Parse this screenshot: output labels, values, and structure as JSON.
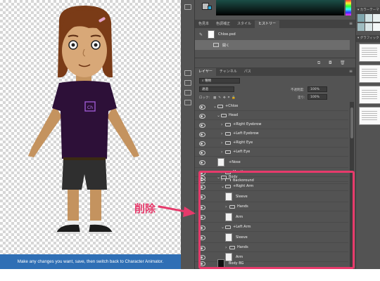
{
  "canvas": {
    "tip_text": "Make any changes you want, save, then switch back to Character Animator.",
    "character": {
      "shirt_color": "#2d1038",
      "badge_text": "Ch",
      "badge_color": "#9b59d0"
    }
  },
  "history_panel": {
    "tabs": [
      "色見本",
      "色調補正",
      "スタイル",
      "ヒストリー"
    ],
    "active_tab": "ヒストリー",
    "snapshot_name": "Chloe.psd",
    "open_state": "開く"
  },
  "layers_panel": {
    "tabs": [
      "レイヤー",
      "チャンネル",
      "パス"
    ],
    "active_tab": "レイヤー",
    "filter_label": "種類",
    "blend_mode": "通過",
    "opacity_label": "不透明度:",
    "opacity_value": "100%",
    "lock_label": "ロック:",
    "fill_label": "塗り:",
    "fill_value": "100%",
    "layers": [
      {
        "name": "+Chloe",
        "type": "group"
      },
      {
        "name": "Head",
        "type": "group"
      },
      {
        "name": "+Right Eyebrow",
        "type": "group"
      },
      {
        "name": "+Left Eyebrow",
        "type": "group"
      },
      {
        "name": "+Right Eye",
        "type": "group"
      },
      {
        "name": "+Left Eye",
        "type": "group"
      },
      {
        "name": "+Nose",
        "type": "layer"
      },
      {
        "name": "Mouth",
        "type": "group"
      },
      {
        "name": "Background",
        "type": "group"
      },
      {
        "name": "Body",
        "type": "group"
      },
      {
        "name": "+Right Arm",
        "type": "group"
      },
      {
        "name": "Sleeve",
        "type": "layer"
      },
      {
        "name": "Hands",
        "type": "group"
      },
      {
        "name": "Arm",
        "type": "layer"
      },
      {
        "name": "+Left Arm",
        "type": "group"
      },
      {
        "name": "Sleeve",
        "type": "layer"
      },
      {
        "name": "Hands",
        "type": "group"
      },
      {
        "name": "Arm",
        "type": "layer"
      },
      {
        "name": "Body BG",
        "type": "layer"
      }
    ]
  },
  "right_panel": {
    "color_header": "カラーテーマ",
    "graphic_header": "グラフィック"
  },
  "annotation": {
    "label": "削除",
    "color": "#e73a6b"
  }
}
